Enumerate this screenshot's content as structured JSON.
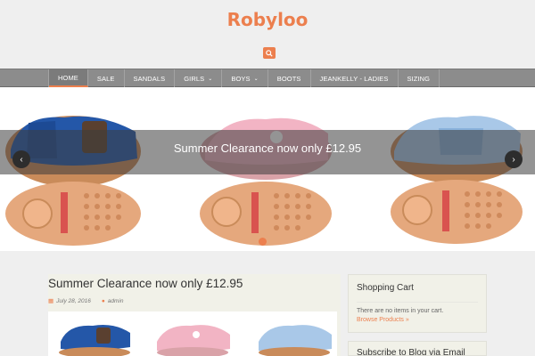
{
  "site": {
    "title": "Robyloo"
  },
  "nav": {
    "items": [
      "HOME",
      "SALE",
      "SANDALS",
      "GIRLS",
      "BOYS",
      "BOOTS",
      "JEANKELLY - LADIES",
      "SIZING"
    ]
  },
  "slider": {
    "caption": "Summer Clearance now only £12.95",
    "prev": "‹",
    "next": "›"
  },
  "post": {
    "title": "Summer Clearance now only £12.95",
    "date": "July 28, 2016",
    "author": "admin"
  },
  "sidebar": {
    "cart_title": "Shopping Cart",
    "cart_empty": "There are no items in your cart.",
    "cart_link": "Browse Products »",
    "subscribe_title": "Subscribe to Blog via Email"
  },
  "colors": {
    "accent": "#ec7f4e",
    "nav_bg": "#8c8c8c",
    "background": "#efefef"
  }
}
